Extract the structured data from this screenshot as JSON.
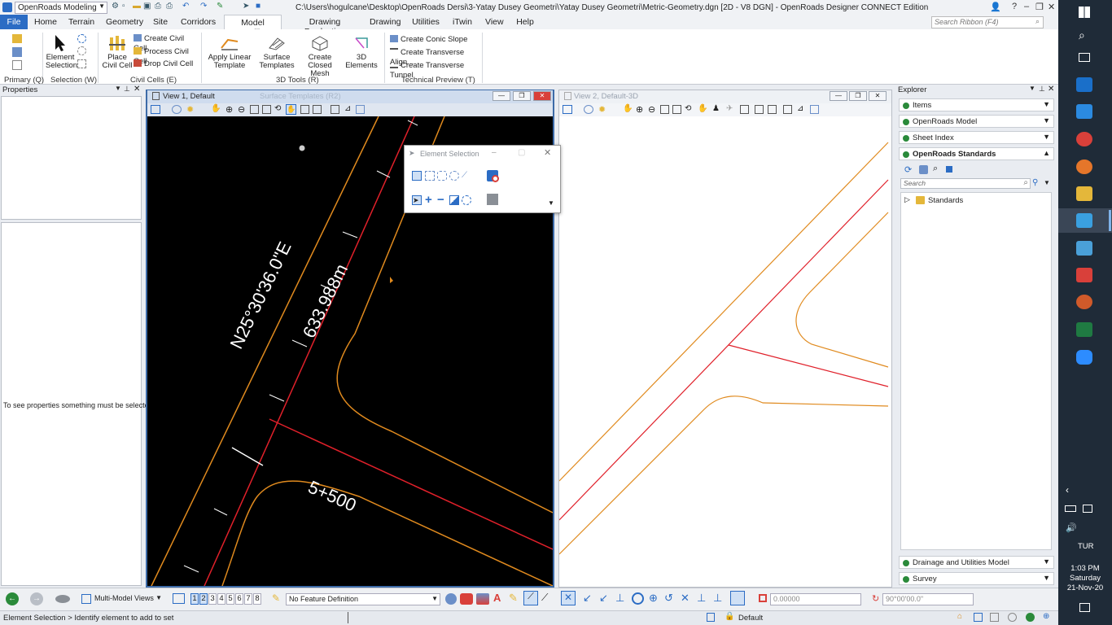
{
  "titlebar": {
    "workflow": "OpenRoads Modeling",
    "title": "C:\\Users\\hogulcane\\Desktop\\OpenRoads Dersi\\3-Yatay Dusey Geometri\\Yatay Dusey Geometri\\Metric-Geometry.dgn [2D - V8 DGN] - OpenRoads Designer CONNECT Edition",
    "search_placeholder": "Search Ribbon (F4)"
  },
  "menu": {
    "tabs": [
      "File",
      "Home",
      "Terrain",
      "Geometry",
      "Site",
      "Corridors",
      "Model Detailing",
      "Drawing Production",
      "Drawing",
      "Utilities",
      "iTwin",
      "View",
      "Help"
    ],
    "active": "Model Detailing"
  },
  "ribbon": {
    "element_selection": "Element Selection",
    "place_civil_cell": "Place Civil Cell",
    "create_civil_cell": "Create Civil Cell",
    "process_civil_cell": "Process Civil Cell",
    "drop_civil_cell": "Drop Civil Cell",
    "apply_linear_template": "Apply Linear Template",
    "surface_templates": "Surface Templates",
    "create_closed_mesh": "Create Closed Mesh",
    "elements_3d": "3D Elements",
    "create_conic_slope": "Create Conic Slope",
    "create_transverse_align": "Create Transverse Align...",
    "create_transverse_tunnel": "Create Transverse Tunnel",
    "groups": {
      "primary": "Primary (Q)",
      "selection": "Selection (W)",
      "civil_cells": "Civil Cells (E)",
      "tools_3d": "3D Tools (R)",
      "technical_preview": "Technical Preview (T)"
    }
  },
  "properties": {
    "title": "Properties",
    "message": "To see properties something must be selected."
  },
  "view1": {
    "title": "View 1, Default",
    "ghost_title": "Surface Templates (R2)",
    "bearing_label": "N25°30'36.0\"E",
    "length_label": "633.988m",
    "station_label": "5+500"
  },
  "view2": {
    "title": "View 2, Default-3D"
  },
  "dialog": {
    "title": "Element Selection"
  },
  "explorer": {
    "title": "Explorer",
    "items": "Items",
    "openroads_model": "OpenRoads Model",
    "sheet_index": "Sheet Index",
    "openroads_standards": "OpenRoads Standards",
    "search_placeholder": "Search",
    "tree_root": "Standards",
    "drainage": "Drainage and Utilities Model",
    "survey": "Survey"
  },
  "bottombar": {
    "view_mode": "Multi-Model Views",
    "view_numbers": [
      "1",
      "2",
      "3",
      "4",
      "5",
      "6",
      "7",
      "8"
    ],
    "feature_definition": "No Feature Definition",
    "distance": "0.00000",
    "angle": "90°00'00.0\""
  },
  "status": {
    "prompt": "Element Selection > Identify element to add to set",
    "level": "Default"
  },
  "taskbar": {
    "lang": "TUR",
    "time": "1:03 PM",
    "day": "Saturday",
    "date": "21-Nov-20"
  },
  "colors": {
    "accent": "#2b6cc4",
    "orange_line": "#e08a1e",
    "red_line": "#e0202a"
  }
}
